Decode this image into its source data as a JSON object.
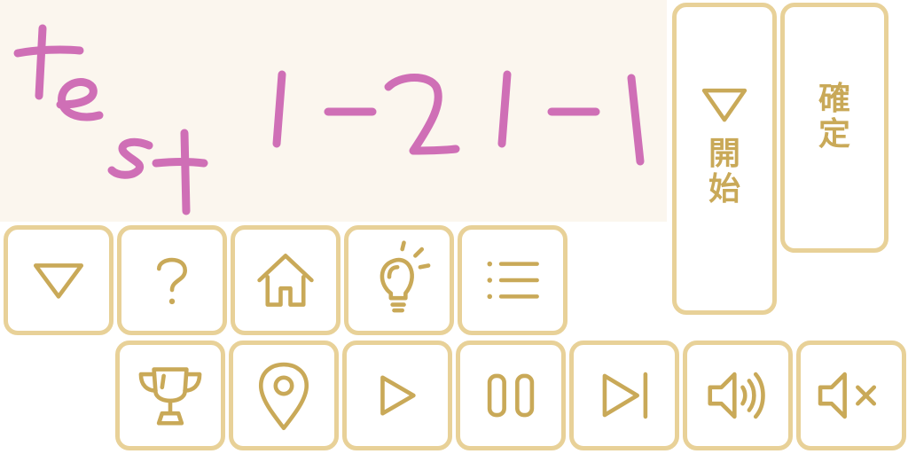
{
  "canvas": {
    "handwritten_text": "test 1-2 1-1",
    "ink_color": "#cf6fb6",
    "background_color": "#fbf6ee"
  },
  "theme": {
    "button_border": "#e8d198",
    "icon_color": "#c9a958"
  },
  "buttons": {
    "start": {
      "char1": "開",
      "char2": "始",
      "icon": "triangle-down-icon"
    },
    "confirm": {
      "char1": "確",
      "char2": "定"
    },
    "row1": [
      "triangle-down-icon",
      "question-icon",
      "home-icon",
      "lightbulb-icon",
      "list-icon"
    ],
    "row2": [
      "trophy-icon",
      "map-pin-icon",
      "play-icon",
      "pause-icon",
      "skip-next-icon",
      "volume-icon",
      "mute-icon"
    ]
  }
}
